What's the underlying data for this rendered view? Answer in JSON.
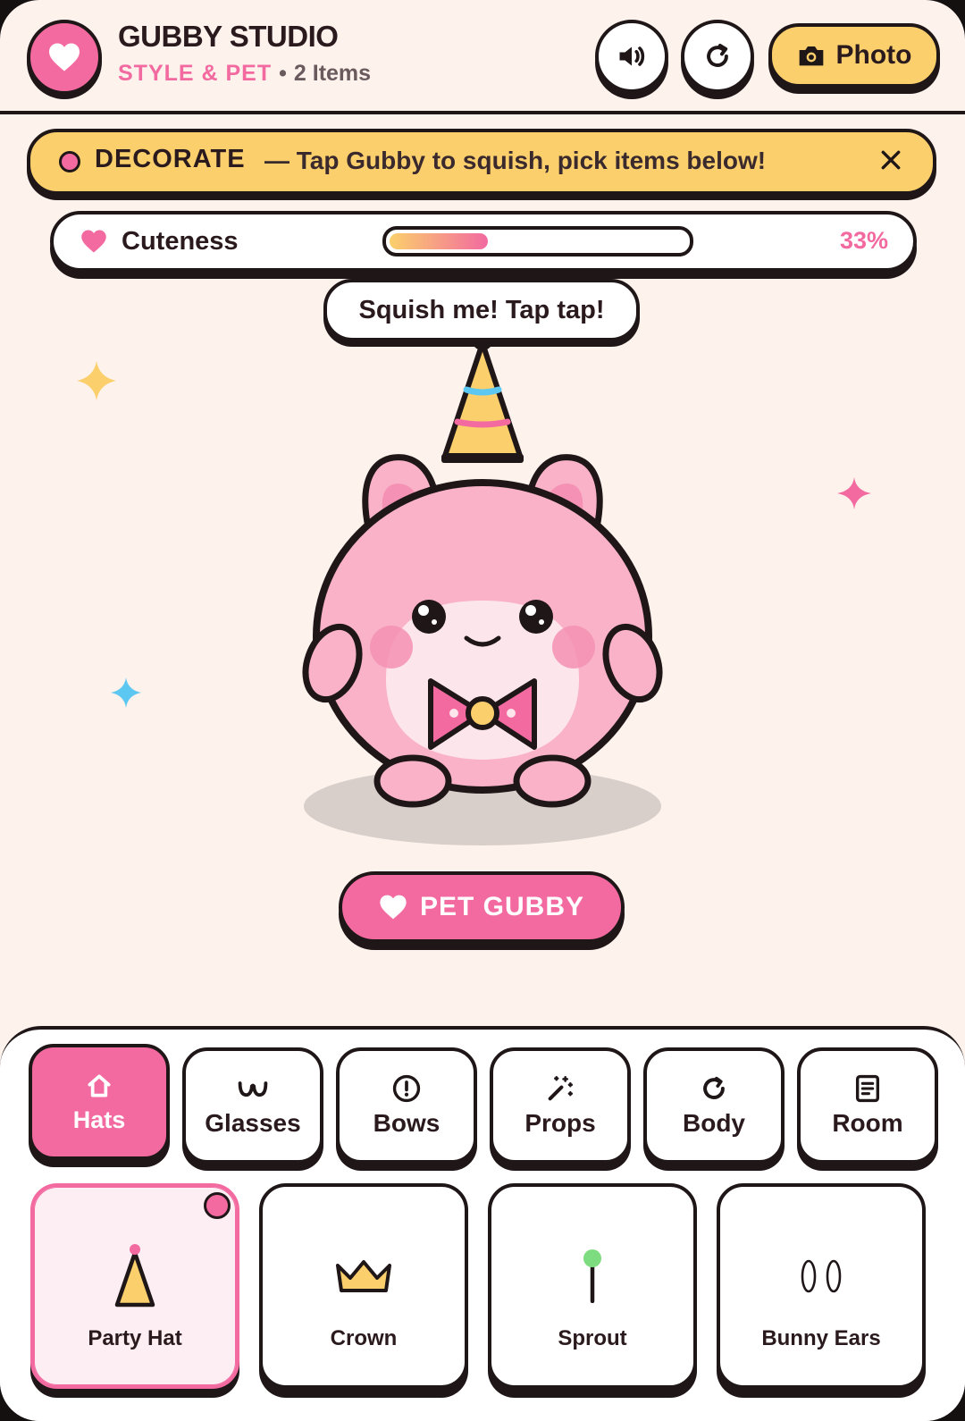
{
  "header": {
    "title": "GUBBY STUDIO",
    "mode": "STYLE & PET",
    "separator": "•",
    "item_count": "2 Items",
    "photo_label": "Photo"
  },
  "banner": {
    "tag": "DECORATE",
    "message": "— Tap Gubby to squish, pick items below!"
  },
  "meter": {
    "label": "Cuteness",
    "value_text": "33%",
    "value": 0.33
  },
  "speech": "Squish me! Tap tap!",
  "pet_button": "PET GUBBY",
  "tabs": [
    {
      "label": "Hats",
      "icon": "home-icon",
      "active": true
    },
    {
      "label": "Glasses",
      "icon": "glasses-icon",
      "active": false
    },
    {
      "label": "Bows",
      "icon": "alert-circle-icon",
      "active": false
    },
    {
      "label": "Props",
      "icon": "magic-wand-icon",
      "active": false
    },
    {
      "label": "Body",
      "icon": "refresh-icon",
      "active": false
    },
    {
      "label": "Room",
      "icon": "document-icon",
      "active": false
    }
  ],
  "items": [
    {
      "label": "Party Hat",
      "icon": "party-hat-icon",
      "selected": true
    },
    {
      "label": "Crown",
      "icon": "crown-icon",
      "selected": false
    },
    {
      "label": "Sprout",
      "icon": "sprout-icon",
      "selected": false
    },
    {
      "label": "Bunny Ears",
      "icon": "bunny-ears-icon",
      "selected": false
    }
  ],
  "colors": {
    "accent_pink": "#f26aa0",
    "accent_yellow": "#fbd06c",
    "background": "#fdf2ec",
    "outline": "#1f1618"
  }
}
